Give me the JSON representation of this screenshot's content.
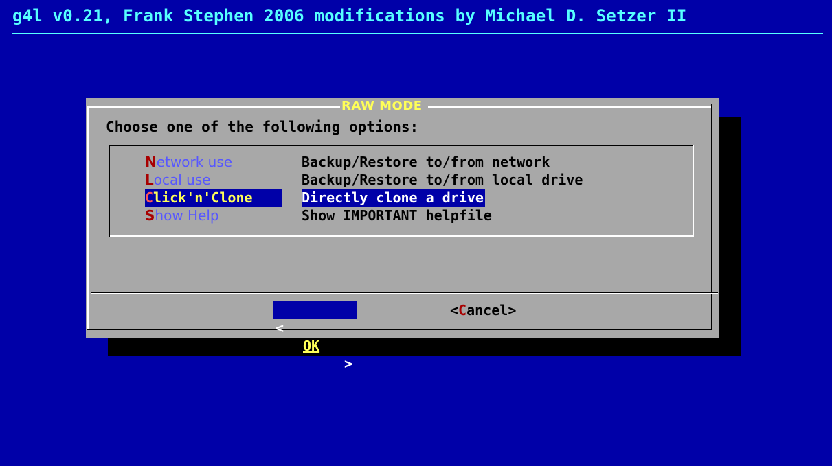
{
  "backtitle": "g4l v0.21, Frank Stephen 2006 modifications by Michael D. Setzer II",
  "dialog": {
    "title": "RAW MODE",
    "prompt": "Choose one of the following options:",
    "menu": [
      {
        "hotkey": "N",
        "rest": "etwork use",
        "description": "Backup/Restore to/from network",
        "selected": false
      },
      {
        "hotkey": "L",
        "rest": "ocal use",
        "description": "Backup/Restore to/from local drive",
        "selected": false
      },
      {
        "hotkey": "C",
        "rest": "lick'n'Clone",
        "description": "Directly clone a drive",
        "selected": true
      },
      {
        "hotkey": "S",
        "rest": "how Help",
        "description": "Show IMPORTANT helpfile",
        "selected": false
      }
    ],
    "buttons": {
      "ok": {
        "left_bracket": "<",
        "label": "OK",
        "right_bracket": ">"
      },
      "cancel": {
        "left_bracket": "<",
        "hotkey": "C",
        "rest": "ancel",
        "right_bracket": ">"
      }
    }
  },
  "colors": {
    "screen_bg": "#0000a8",
    "dialog_bg": "#a8a8a8",
    "title": "#ffff57",
    "backtitle": "#57ffff",
    "hotkey": "#a80000",
    "selected_bg": "#0000a8"
  }
}
